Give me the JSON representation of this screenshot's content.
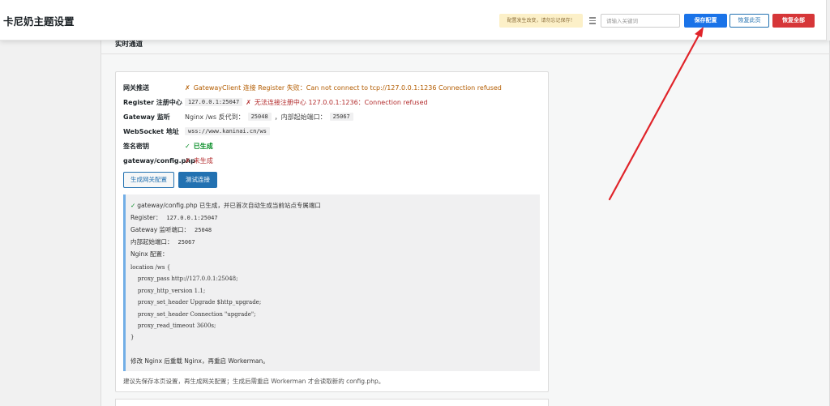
{
  "header": {
    "title": "卡尼奶主题设置",
    "notice": "配置发生改变，请勿忘记保存！",
    "search_placeholder": "请输入关键词",
    "save_label": "保存配置",
    "reset_page_label": "恢复此页",
    "reset_all_label": "恢复全部"
  },
  "section": {
    "title": "实时通道"
  },
  "rows": [
    {
      "label": "网关推送",
      "status_icon": "✗",
      "text": "GatewayClient 连接 Register 失败：Can not connect to tcp://127.0.0.1:1236 Connection refused"
    },
    {
      "label": "Register 注册中心",
      "code": "127.0.0.1:25047",
      "status_icon": "✗",
      "text": "无法连接注册中心 127.0.0.1:1236：Connection refused"
    },
    {
      "label": "Gateway 监听",
      "prefix": "Nginx /ws 反代到：",
      "code1": "25048",
      "mid": "，内部起始端口：",
      "code2": "25067"
    },
    {
      "label": "WebSocket 地址",
      "code": "wss://www.kaninai.cn/ws"
    },
    {
      "label": "签名密钥",
      "status_icon": "✓",
      "text": "已生成"
    },
    {
      "label": "gateway/config.php",
      "status_icon": "✗",
      "text": "未生成"
    }
  ],
  "buttons": {
    "generate": "生成网关配置",
    "test": "测试连接"
  },
  "info": {
    "check": "✓",
    "headline": "gateway/config.php 已生成，并已首次自动生成当前站点专属端口",
    "register_label": "Register：",
    "register_code": "127.0.0.1:25047",
    "gateway_label": "Gateway 监听端口：",
    "gateway_code": "25048",
    "internal_label": "内部起始端口：",
    "internal_code": "25067",
    "nginx_label": "Nginx 配置：",
    "code_lines": [
      "location /ws {",
      "    proxy_pass http://127.0.0.1:25048;",
      "    proxy_http_version 1.1;",
      "    proxy_set_header Upgrade $http_upgrade;",
      "    proxy_set_header Connection \"upgrade\";",
      "    proxy_read_timeout 3600s;",
      "}"
    ],
    "footer": "修改 Nginx 后重载 Nginx，再重启 Workerman。"
  },
  "note": "建议先保存本页设置，再生成网关配置；生成后需重启 Workerman 才会读取新的 config.php。",
  "colors": {
    "save": "#1a73e8",
    "reset_all": "#d63638",
    "error": "#b32d2e",
    "ok": "#008a20",
    "arrow": "#e0242a"
  }
}
